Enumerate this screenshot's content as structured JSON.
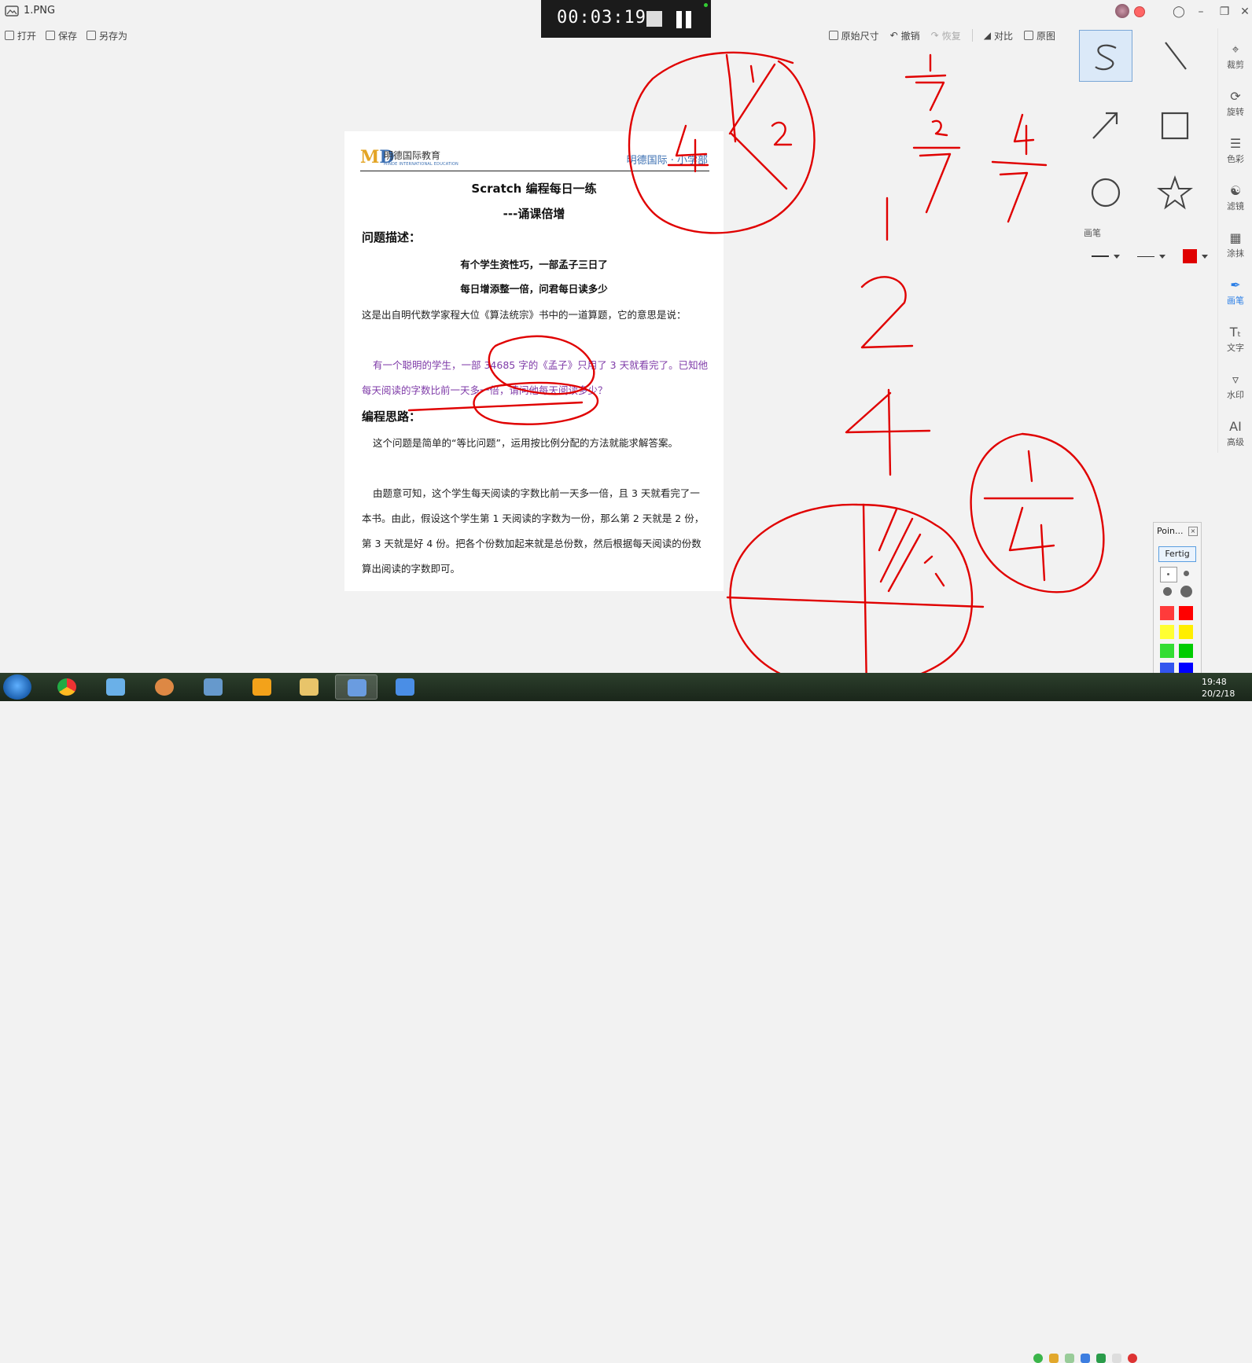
{
  "window": {
    "title": "1.PNG",
    "controls": [
      "minimize",
      "maximize",
      "close"
    ]
  },
  "toolbar_left": [
    {
      "label": "打开",
      "icon": "folder-icon"
    },
    {
      "label": "保存",
      "icon": "save-icon"
    },
    {
      "label": "另存为",
      "icon": "save-as-icon"
    }
  ],
  "toolbar_right": [
    {
      "label": "原始尺寸",
      "icon": "original-size-icon",
      "enabled": true
    },
    {
      "label": "撤销",
      "icon": "undo-icon",
      "enabled": true
    },
    {
      "label": "恢复",
      "icon": "redo-icon",
      "enabled": false
    },
    {
      "label": "对比",
      "icon": "compare-icon",
      "enabled": true
    },
    {
      "label": "原图",
      "icon": "original-image-icon",
      "enabled": true
    }
  ],
  "recorder": {
    "time": "00:03:19"
  },
  "document": {
    "logo_text": "明德国际教育",
    "logo_sub": "MINDE INTERNATIONAL EDUCATION",
    "school": "明德国际 · 小学部",
    "title": "Scratch  编程每日一练",
    "subtitle": "---诵课倍增",
    "section1": "问题描述：",
    "poem_line1": "有个学生资性巧，一部孟子三日了",
    "poem_line2": "每日增添整一倍，问君每日读多少",
    "p1": "这是出自明代数学家程大位《算法统宗》书中的一道算题，它的意思是说：",
    "p2": "有一个聪明的学生，一部 34685 字的《孟子》只用了 3 天就看完了。已知他每天阅读的字数比前一天多一倍，请问他每天阅读多少？",
    "section2": "编程思路：",
    "p3": "这个问题是简单的“等比问题”，运用按比例分配的方法就能求解答案。",
    "p4": "由题意可知，这个学生每天阅读的字数比前一天多一倍，且 3 天就看完了一本书。由此，假设这个学生第 1 天阅读的字数为一份，那么第 2 天就是 2 份，第 3 天就是好 4 份。把各个份数加起来就是总份数，然后根据每天阅读的份数算出阅读的字数即可。"
  },
  "draw_tools": [
    "curve-pen-icon",
    "line-icon",
    "arrow-icon",
    "rectangle-icon",
    "circle-icon",
    "star-icon"
  ],
  "pen": {
    "label": "画笔",
    "color": "#e00000"
  },
  "sidebar": [
    {
      "label": "裁剪",
      "icon": "crop-icon"
    },
    {
      "label": "旋转",
      "icon": "rotate-icon"
    },
    {
      "label": "色彩",
      "icon": "color-adjust-icon"
    },
    {
      "label": "滤镜",
      "icon": "filter-icon"
    },
    {
      "label": "涂抹",
      "icon": "smudge-icon"
    },
    {
      "label": "画笔",
      "icon": "brush-icon",
      "active": true
    },
    {
      "label": "文字",
      "icon": "text-icon"
    },
    {
      "label": "水印",
      "icon": "watermark-icon"
    },
    {
      "label": "高级",
      "icon": "ai-icon",
      "glyph": "AI"
    }
  ],
  "pointer_panel": {
    "title": "Poin...",
    "done": "Fertig",
    "colors": [
      "#ff3b3b",
      "#ff0000",
      "#ffff33",
      "#ffee00",
      "#33dd33",
      "#00cc00",
      "#3355ee",
      "#0000ff",
      "#ffffff",
      "#000000"
    ]
  },
  "clock": {
    "time": "19:48",
    "date": "20/2/18"
  },
  "annotation": {
    "color": "#e00000",
    "labels": [
      "1",
      "2",
      "4",
      "1",
      "7",
      "2",
      "7",
      "4",
      "7",
      "1",
      "2",
      "4",
      "1",
      "4",
      "1"
    ]
  }
}
